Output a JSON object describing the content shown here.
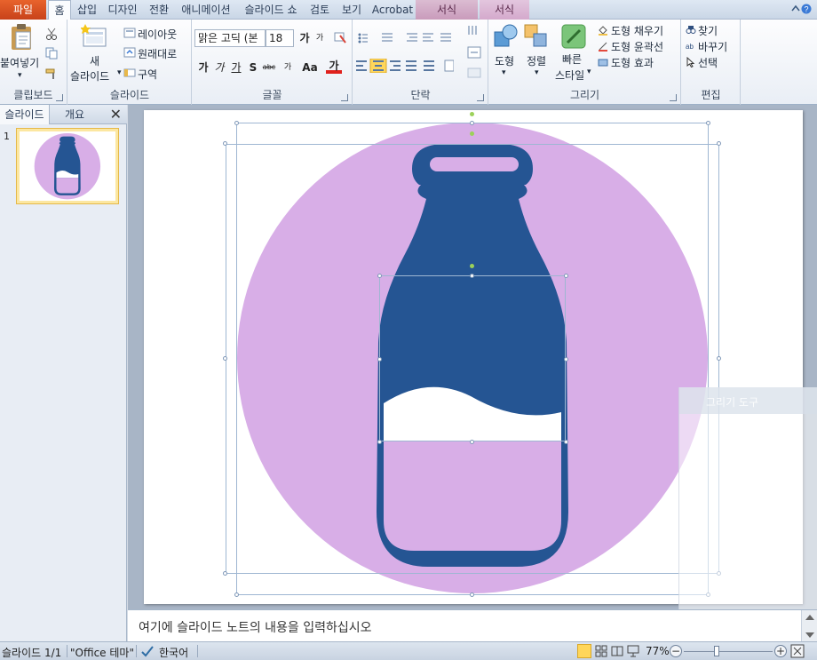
{
  "tabs": {
    "file": "파일",
    "home": "홈",
    "insert": "삽입",
    "design": "디자인",
    "transitions": "전환",
    "animations": "애니메이션",
    "slideshow": "슬라이드 쇼",
    "review": "검토",
    "view": "보기",
    "acrobat": "Acrobat",
    "format1": "서식",
    "format2": "서식"
  },
  "ribbon": {
    "clipboard": {
      "paste": "붙여넣기",
      "label": "클립보드"
    },
    "slides": {
      "new_slide_1": "새",
      "new_slide_2": "슬라이드",
      "layout": "레이아웃",
      "reset": "원래대로",
      "section": "구역",
      "label": "슬라이드"
    },
    "font": {
      "name": "맑은 고딕 (본",
      "size": "18",
      "grow": "가",
      "shrink": "가",
      "bold": "가",
      "italic": "가",
      "underline": "가",
      "shadow": "S",
      "strike": "abc",
      "spacing": "가",
      "case": "Aa",
      "color": "가",
      "label": "글꼴"
    },
    "paragraph": {
      "label": "단락"
    },
    "drawing": {
      "shapes": "도형",
      "arrange": "정렬",
      "quick_styles_1": "빠른",
      "quick_styles_2": "스타일",
      "fill": "도형 채우기",
      "outline": "도형 윤곽선",
      "effects": "도형 효과",
      "label": "그리기"
    },
    "editing": {
      "find": "찾기",
      "replace": "바꾸기",
      "select": "선택",
      "label": "편집"
    }
  },
  "left_pane": {
    "tab_slides": "슬라이드",
    "tab_outline": "개요",
    "close": "✕",
    "slide_number": "1"
  },
  "floating_toolbar": {
    "label": "그리기 도구"
  },
  "notes": {
    "placeholder": "여기에 슬라이드 노트의 내용을 입력하십시오"
  },
  "status": {
    "slide_counter": "슬라이드 1/1",
    "theme": "\"Office 테마\"",
    "language": "한국어",
    "zoom": "77%",
    "zoom_value": 77
  },
  "colors": {
    "circle": "#d8aee7",
    "bottle": "#255593",
    "milk": "#ffffff",
    "file_tab": "#d9532a",
    "context_tab": "#d4a9cc",
    "accent": "#ffd65a"
  }
}
